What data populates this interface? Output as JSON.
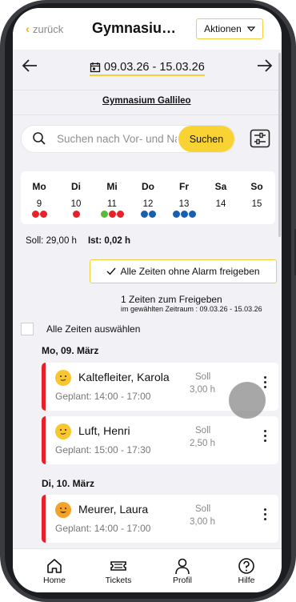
{
  "header": {
    "back_label": "zurück",
    "title": "Gymnasiu…",
    "actions_label": "Aktionen"
  },
  "date_range": {
    "label": "09.03.26 - 15.03.26"
  },
  "school": "Gymnasium Gallileo",
  "search": {
    "placeholder": "Suchen nach Vor- und Nachname",
    "button_label": "Suchen"
  },
  "week": {
    "days": [
      {
        "name": "Mo",
        "date": "9",
        "dots": [
          "#e8202a",
          "#e8202a"
        ]
      },
      {
        "name": "Di",
        "date": "10",
        "dots": [
          "#e8202a"
        ]
      },
      {
        "name": "Mi",
        "date": "11",
        "dots": [
          "#5cb83a",
          "#e8202a",
          "#e8202a"
        ]
      },
      {
        "name": "Do",
        "date": "12",
        "dots": [
          "#1a5fae",
          "#1a5fae"
        ]
      },
      {
        "name": "Fr",
        "date": "13",
        "dots": [
          "#1a5fae",
          "#1a5fae",
          "#1a5fae"
        ]
      },
      {
        "name": "Sa",
        "date": "14",
        "dots": []
      },
      {
        "name": "So",
        "date": "15",
        "dots": []
      }
    ]
  },
  "totals": {
    "soll": "Soll: 29,00 h",
    "ist": "Ist: 0,02 h"
  },
  "release": {
    "button_label": "Alle Zeiten ohne Alarm freigeben",
    "count_text": "1 Zeiten zum Freigeben",
    "range_text": "im gewählten Zeitraum : 09.03.26 - 15.03.26"
  },
  "select_all_label": "Alle Zeiten auswählen",
  "groups": [
    {
      "date": "Mo, 09. März",
      "entries": [
        {
          "name": "Kaltefleiter, Karola",
          "plan": "Geplant: 14:00 - 17:00",
          "soll_label": "Soll",
          "soll_value": "3,00 h",
          "face": "yellow"
        },
        {
          "name": "Luft, Henri",
          "plan": "Geplant: 15:00 - 17:30",
          "soll_label": "Soll",
          "soll_value": "2,50 h",
          "face": "yellow"
        }
      ]
    },
    {
      "date": "Di, 10. März",
      "entries": [
        {
          "name": "Meurer, Laura",
          "plan": "Geplant: 14:00 - 17:00",
          "soll_label": "Soll",
          "soll_value": "3,00 h",
          "face": "orange"
        }
      ]
    }
  ],
  "nav": {
    "items": [
      {
        "label": "Home",
        "icon": "home-icon"
      },
      {
        "label": "Tickets",
        "icon": "ticket-icon"
      },
      {
        "label": "Profil",
        "icon": "user-icon"
      },
      {
        "label": "Hilfe",
        "icon": "help-icon"
      }
    ]
  },
  "colors": {
    "accent": "#f9d233",
    "alarm": "#e8202a",
    "blue": "#1a5fae",
    "green": "#5cb83a"
  }
}
